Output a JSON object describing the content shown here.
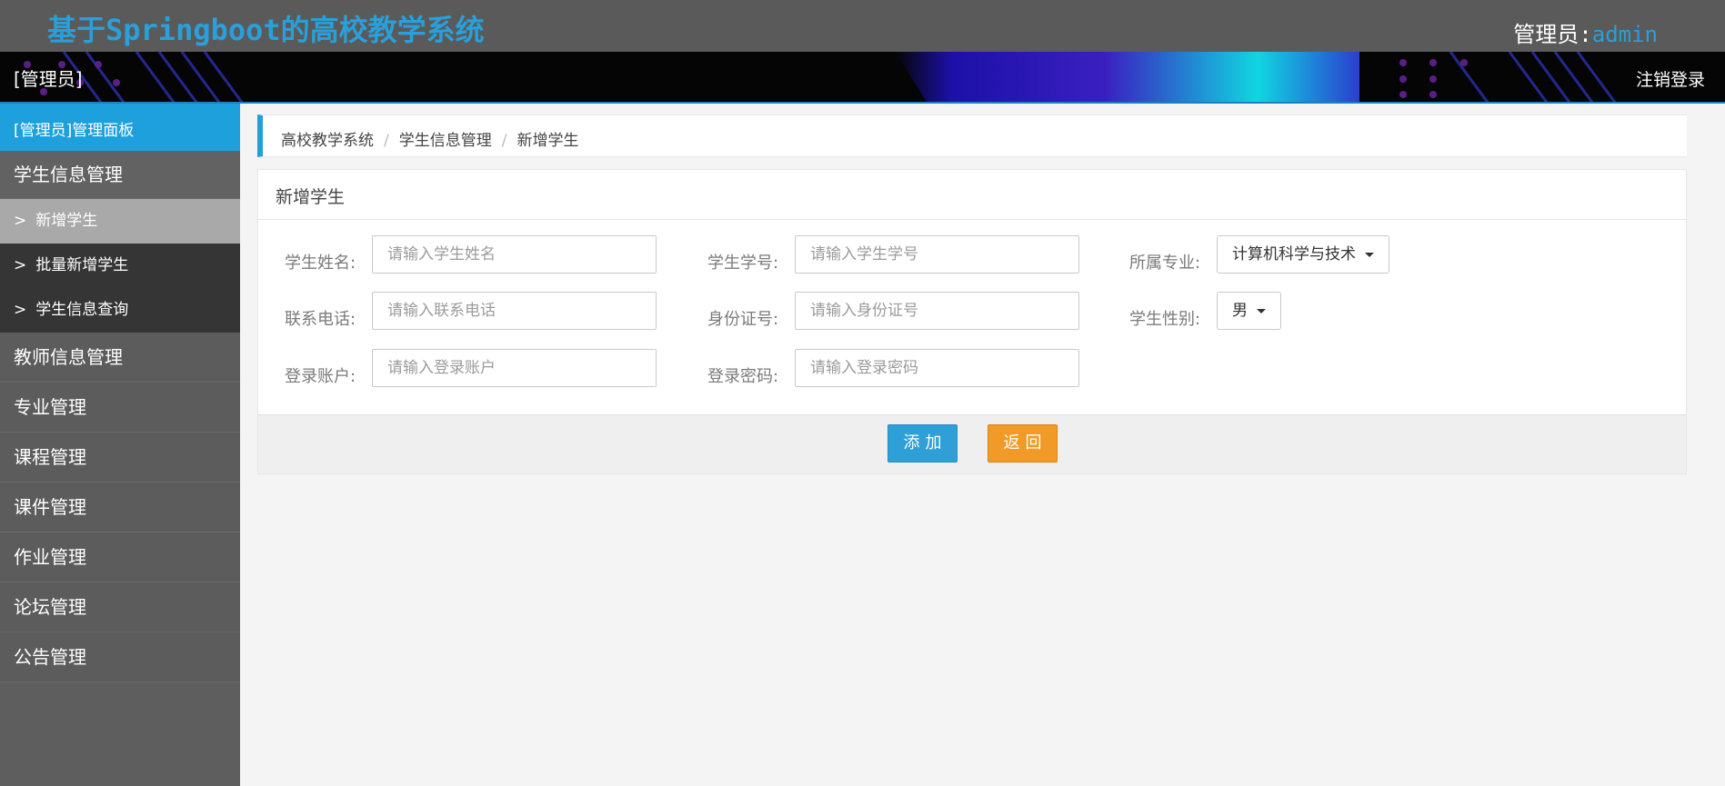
{
  "header": {
    "app_title": "基于Springboot的高校教学系统",
    "admin_label": "管理员:",
    "admin_name": "admin"
  },
  "banner": {
    "role_label": "[管理员]",
    "logout_label": "注销登录"
  },
  "sidebar": {
    "panel_label": "[管理员]管理面板",
    "items": [
      {
        "label": "学生信息管理"
      },
      {
        "label": "教师信息管理"
      },
      {
        "label": "专业管理"
      },
      {
        "label": "课程管理"
      },
      {
        "label": "课件管理"
      },
      {
        "label": "作业管理"
      },
      {
        "label": "论坛管理"
      },
      {
        "label": "公告管理"
      }
    ],
    "sub_items": [
      {
        "arrow": ">",
        "label": "新增学生",
        "active": true
      },
      {
        "arrow": ">",
        "label": "批量新增学生",
        "active": false
      },
      {
        "arrow": ">",
        "label": "学生信息查询",
        "active": false
      }
    ]
  },
  "breadcrumb": {
    "items": [
      "高校教学系统",
      "学生信息管理",
      "新增学生"
    ],
    "separator": "/"
  },
  "form": {
    "title": "新增学生",
    "fields": {
      "name": {
        "label": "学生姓名:",
        "placeholder": "请输入学生姓名",
        "value": ""
      },
      "student_no": {
        "label": "学生学号:",
        "placeholder": "请输入学生学号",
        "value": ""
      },
      "major": {
        "label": "所属专业:",
        "selected": "计算机科学与技术"
      },
      "phone": {
        "label": "联系电话:",
        "placeholder": "请输入联系电话",
        "value": ""
      },
      "id_card": {
        "label": "身份证号:",
        "placeholder": "请输入身份证号",
        "value": ""
      },
      "gender": {
        "label": "学生性别:",
        "selected": "男"
      },
      "account": {
        "label": "登录账户:",
        "placeholder": "请输入登录账户",
        "value": ""
      },
      "password": {
        "label": "登录密码:",
        "placeholder": "请输入登录密码",
        "value": ""
      }
    },
    "add_label": "添加",
    "back_label": "返回"
  },
  "colors": {
    "accent": "#1ea0dc",
    "add_button": "#2f9fd8",
    "back_button": "#f19a28",
    "sidebar_bg": "#5e5e5e",
    "topbar_bg": "#5a5a5a"
  }
}
